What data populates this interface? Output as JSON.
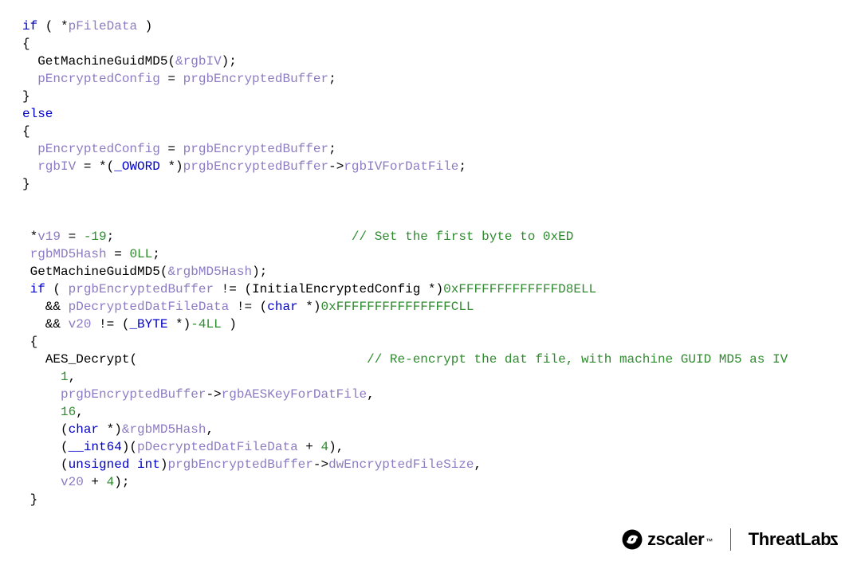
{
  "code": {
    "lines": [
      [
        {
          "c": "kw",
          "t": "if"
        },
        {
          "c": "punct",
          "t": " ( "
        },
        {
          "c": "starop",
          "t": "*"
        },
        {
          "c": "id",
          "t": "pFileData"
        },
        {
          "c": "punct",
          "t": " )"
        }
      ],
      [
        {
          "c": "punct",
          "t": "{"
        }
      ],
      [
        {
          "c": "punct",
          "t": "  "
        },
        {
          "c": "fn",
          "t": "GetMachineGuidMD5"
        },
        {
          "c": "punct",
          "t": "("
        },
        {
          "c": "amp",
          "t": "&"
        },
        {
          "c": "id",
          "t": "rgbIV"
        },
        {
          "c": "punct",
          "t": ");"
        }
      ],
      [
        {
          "c": "punct",
          "t": "  "
        },
        {
          "c": "id",
          "t": "pEncryptedConfig"
        },
        {
          "c": "punct",
          "t": " = "
        },
        {
          "c": "id",
          "t": "prgbEncryptedBuffer"
        },
        {
          "c": "punct",
          "t": ";"
        }
      ],
      [
        {
          "c": "punct",
          "t": "}"
        }
      ],
      [
        {
          "c": "kw",
          "t": "else"
        }
      ],
      [
        {
          "c": "punct",
          "t": "{"
        }
      ],
      [
        {
          "c": "punct",
          "t": "  "
        },
        {
          "c": "id",
          "t": "pEncryptedConfig"
        },
        {
          "c": "punct",
          "t": " = "
        },
        {
          "c": "id",
          "t": "prgbEncryptedBuffer"
        },
        {
          "c": "punct",
          "t": ";"
        }
      ],
      [
        {
          "c": "punct",
          "t": "  "
        },
        {
          "c": "id",
          "t": "rgbIV"
        },
        {
          "c": "punct",
          "t": " = *("
        },
        {
          "c": "cast",
          "t": "_OWORD"
        },
        {
          "c": "punct",
          "t": " *)"
        },
        {
          "c": "id",
          "t": "prgbEncryptedBuffer"
        },
        {
          "c": "punct",
          "t": "->"
        },
        {
          "c": "field",
          "t": "rgbIVForDatFile"
        },
        {
          "c": "punct",
          "t": ";"
        }
      ],
      [
        {
          "c": "punct",
          "t": "}"
        }
      ],
      [
        {
          "c": "punct",
          "t": ""
        }
      ],
      [
        {
          "c": "punct",
          "t": ""
        }
      ],
      [
        {
          "c": "punct",
          "t": " *"
        },
        {
          "c": "id",
          "t": "v19"
        },
        {
          "c": "punct",
          "t": " = "
        },
        {
          "c": "num",
          "t": "-19"
        },
        {
          "c": "punct",
          "t": ";                               "
        },
        {
          "c": "cmt",
          "t": "// Set the first byte to 0xED"
        }
      ],
      [
        {
          "c": "punct",
          "t": " "
        },
        {
          "c": "id",
          "t": "rgbMD5Hash"
        },
        {
          "c": "punct",
          "t": " = "
        },
        {
          "c": "num",
          "t": "0LL"
        },
        {
          "c": "punct",
          "t": ";"
        }
      ],
      [
        {
          "c": "punct",
          "t": " "
        },
        {
          "c": "fn",
          "t": "GetMachineGuidMD5"
        },
        {
          "c": "punct",
          "t": "("
        },
        {
          "c": "amp",
          "t": "&"
        },
        {
          "c": "id",
          "t": "rgbMD5Hash"
        },
        {
          "c": "punct",
          "t": ");"
        }
      ],
      [
        {
          "c": "punct",
          "t": " "
        },
        {
          "c": "kw",
          "t": "if"
        },
        {
          "c": "punct",
          "t": " ( "
        },
        {
          "c": "id",
          "t": "prgbEncryptedBuffer"
        },
        {
          "c": "punct",
          "t": " != ("
        },
        {
          "c": "fn",
          "t": "InitialEncryptedConfig"
        },
        {
          "c": "punct",
          "t": " *)"
        },
        {
          "c": "hex",
          "t": "0xFFFFFFFFFFFFFD8ELL"
        }
      ],
      [
        {
          "c": "punct",
          "t": "   && "
        },
        {
          "c": "id",
          "t": "pDecryptedDatFileData"
        },
        {
          "c": "punct",
          "t": " != ("
        },
        {
          "c": "cast",
          "t": "char"
        },
        {
          "c": "punct",
          "t": " *)"
        },
        {
          "c": "hex",
          "t": "0xFFFFFFFFFFFFFFFCLL"
        }
      ],
      [
        {
          "c": "punct",
          "t": "   && "
        },
        {
          "c": "id",
          "t": "v20"
        },
        {
          "c": "punct",
          "t": " != ("
        },
        {
          "c": "cast",
          "t": "_BYTE"
        },
        {
          "c": "punct",
          "t": " *)"
        },
        {
          "c": "num",
          "t": "-4LL"
        },
        {
          "c": "punct",
          "t": " )"
        }
      ],
      [
        {
          "c": "punct",
          "t": " {"
        }
      ],
      [
        {
          "c": "punct",
          "t": "   "
        },
        {
          "c": "fn",
          "t": "AES_Decrypt"
        },
        {
          "c": "punct",
          "t": "(                              "
        },
        {
          "c": "cmt",
          "t": "// Re-encrypt the dat file, with machine GUID MD5 as IV"
        }
      ],
      [
        {
          "c": "punct",
          "t": "     "
        },
        {
          "c": "num",
          "t": "1"
        },
        {
          "c": "punct",
          "t": ","
        }
      ],
      [
        {
          "c": "punct",
          "t": "     "
        },
        {
          "c": "id",
          "t": "prgbEncryptedBuffer"
        },
        {
          "c": "punct",
          "t": "->"
        },
        {
          "c": "field",
          "t": "rgbAESKeyForDatFile"
        },
        {
          "c": "punct",
          "t": ","
        }
      ],
      [
        {
          "c": "punct",
          "t": "     "
        },
        {
          "c": "num",
          "t": "16"
        },
        {
          "c": "punct",
          "t": ","
        }
      ],
      [
        {
          "c": "punct",
          "t": "     ("
        },
        {
          "c": "cast",
          "t": "char"
        },
        {
          "c": "punct",
          "t": " *)"
        },
        {
          "c": "amp",
          "t": "&"
        },
        {
          "c": "id",
          "t": "rgbMD5Hash"
        },
        {
          "c": "punct",
          "t": ","
        }
      ],
      [
        {
          "c": "punct",
          "t": "     ("
        },
        {
          "c": "cast",
          "t": "__int64"
        },
        {
          "c": "punct",
          "t": ")("
        },
        {
          "c": "id",
          "t": "pDecryptedDatFileData"
        },
        {
          "c": "punct",
          "t": " + "
        },
        {
          "c": "num",
          "t": "4"
        },
        {
          "c": "punct",
          "t": "),"
        }
      ],
      [
        {
          "c": "punct",
          "t": "     ("
        },
        {
          "c": "cast",
          "t": "unsigned int"
        },
        {
          "c": "punct",
          "t": ")"
        },
        {
          "c": "id",
          "t": "prgbEncryptedBuffer"
        },
        {
          "c": "punct",
          "t": "->"
        },
        {
          "c": "field",
          "t": "dwEncryptedFileSize"
        },
        {
          "c": "punct",
          "t": ","
        }
      ],
      [
        {
          "c": "punct",
          "t": "     "
        },
        {
          "c": "id",
          "t": "v20"
        },
        {
          "c": "punct",
          "t": " + "
        },
        {
          "c": "num",
          "t": "4"
        },
        {
          "c": "punct",
          "t": ");"
        }
      ],
      [
        {
          "c": "punct",
          "t": " }"
        }
      ]
    ]
  },
  "footer": {
    "brand1": "zscaler",
    "tm": "™",
    "brand2_part1": "ThreatLab",
    "brand2_part2": "z"
  }
}
